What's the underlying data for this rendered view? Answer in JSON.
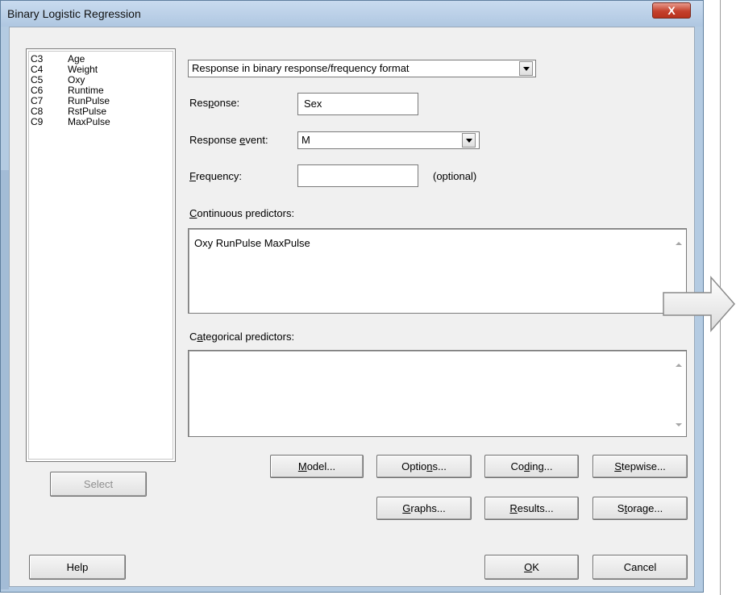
{
  "window": {
    "title": "Binary Logistic Regression",
    "close_glyph": "X"
  },
  "columns": [
    {
      "id": "C3",
      "name": "Age"
    },
    {
      "id": "C4",
      "name": "Weight"
    },
    {
      "id": "C5",
      "name": "Oxy"
    },
    {
      "id": "C6",
      "name": "Runtime"
    },
    {
      "id": "C7",
      "name": "RunPulse"
    },
    {
      "id": "C8",
      "name": "RstPulse"
    },
    {
      "id": "C9",
      "name": "MaxPulse"
    }
  ],
  "format_select": {
    "value": "Response in binary response/frequency format"
  },
  "response": {
    "label_pre": "Res",
    "label_u": "p",
    "label_post": "onse:",
    "value": "Sex"
  },
  "response_event": {
    "label_pre": "Response ",
    "label_u": "e",
    "label_post": "vent:",
    "value": "M"
  },
  "frequency": {
    "label_u": "F",
    "label_post": "requency:",
    "value": "",
    "optional": "(optional)"
  },
  "continuous": {
    "label_u": "C",
    "label_post": "ontinuous predictors:",
    "value": "Oxy RunPulse MaxPulse"
  },
  "categorical": {
    "label_pre": "C",
    "label_u": "a",
    "label_post": "tegorical predictors:",
    "value": ""
  },
  "buttons": {
    "select": "Select",
    "model": {
      "u": "M",
      "post": "odel..."
    },
    "options": {
      "pre": "Optio",
      "u": "n",
      "post": "s..."
    },
    "coding": {
      "pre": "Co",
      "u": "d",
      "post": "ing..."
    },
    "stepwise": {
      "u": "S",
      "post": "tepwise..."
    },
    "graphs": {
      "u": "G",
      "post": "raphs..."
    },
    "results": {
      "u": "R",
      "post": "esults..."
    },
    "storage": {
      "pre": "S",
      "u": "t",
      "post": "orage..."
    },
    "help": "Help",
    "ok": {
      "u": "O",
      "post": "K"
    },
    "cancel": "Cancel"
  },
  "icons": {
    "arrow": "right-arrow-icon"
  }
}
